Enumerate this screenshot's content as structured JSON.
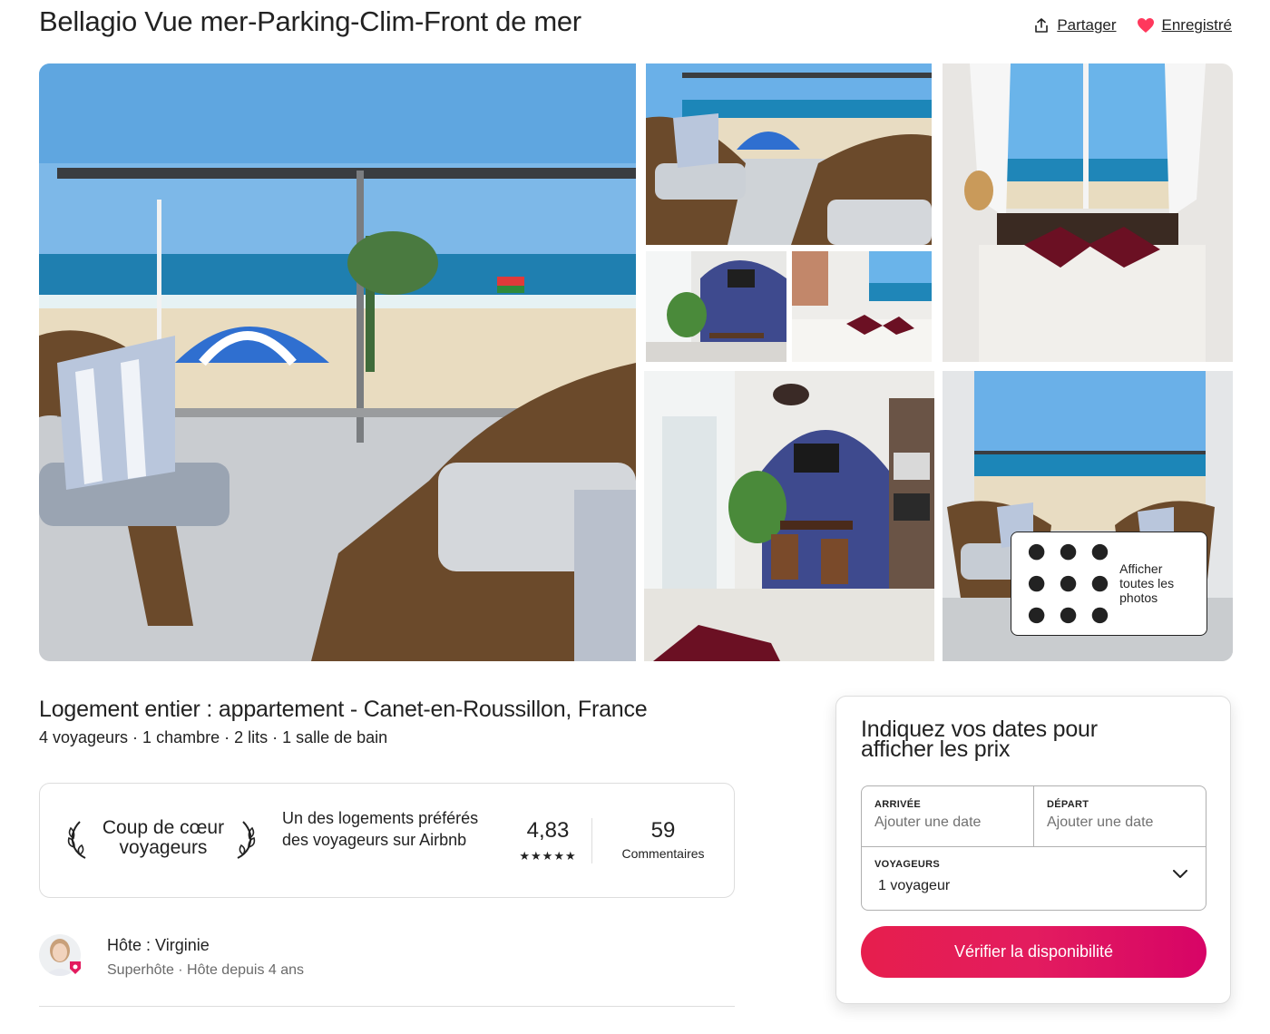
{
  "listing": {
    "title": "Bellagio Vue mer-Parking-Clim-Front de mer",
    "type": "Logement entier : appartement - Canet-en-Roussillon, France",
    "summary": "4 voyageurs · 1 chambre · 2 lits · 1 salle de bain"
  },
  "actions": {
    "share_label": "Partager",
    "saved_label": "Enregistré",
    "share_icon": "share-icon",
    "saved_icon": "heart-icon"
  },
  "gallery": {
    "show_all_label": "Afficher toutes les photos",
    "photos": [
      "balcony-sea-view",
      "balcony-chairs",
      "bedroom-window",
      "living-room",
      "bedroom",
      "dining-area",
      "balcony-terrace"
    ]
  },
  "favorite": {
    "badge_title": "Coup de cœur voyageurs",
    "description": "Un des logements préférés des voyageurs sur Airbnb",
    "rating": "4,83",
    "stars": "★★★★★",
    "reviews_count": "59",
    "reviews_label": "Commentaires"
  },
  "host": {
    "name": "Hôte : Virginie",
    "subtitle": "Superhôte · Hôte depuis 4 ans"
  },
  "booking": {
    "title": "Indiquez vos dates pour afficher les prix",
    "checkin_label": "ARRIVÉE",
    "checkin_placeholder": "Ajouter une date",
    "checkout_label": "DÉPART",
    "checkout_placeholder": "Ajouter une date",
    "guests_label": "VOYAGEURS",
    "guests_value": "1 voyageur",
    "button_label": "Vérifier la disponibilité"
  },
  "colors": {
    "accent": "#e31c5f",
    "heart": "#ff385c",
    "text": "#222222",
    "muted": "#6a6a6a",
    "border": "#dddddd"
  }
}
